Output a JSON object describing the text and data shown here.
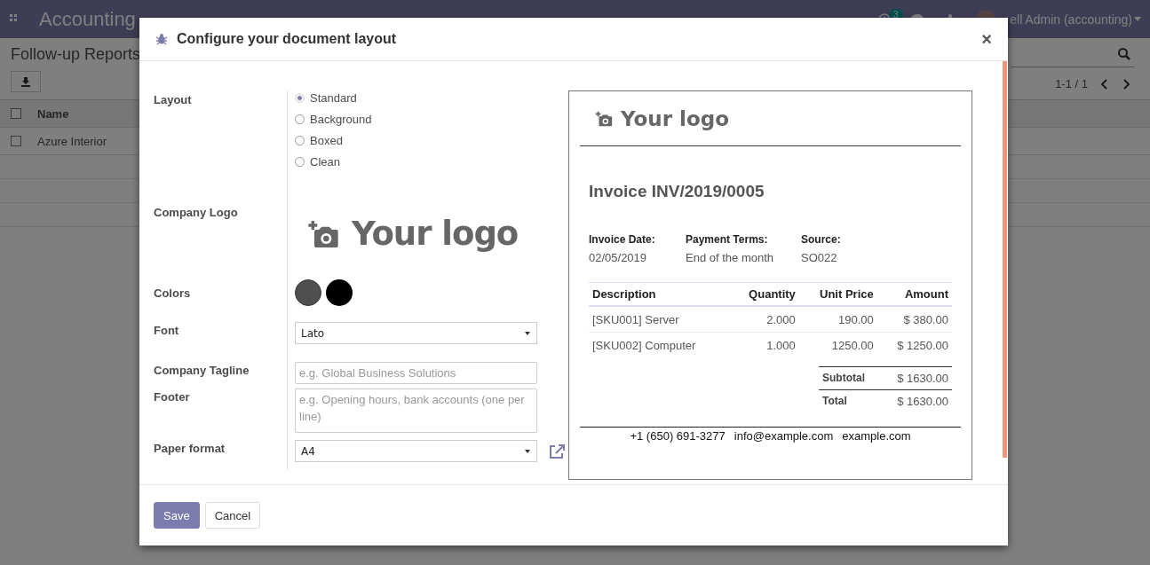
{
  "app": {
    "title": "Accounting",
    "messages_badge": "3",
    "user": "ell Admin (accounting)",
    "breadcrumb": "Follow-up Reports",
    "pager": "1-1 / 1",
    "list": {
      "column": "Name",
      "all_checked": false,
      "rows": [
        {
          "name": "Azure Interior",
          "checked": false
        }
      ]
    }
  },
  "dialog": {
    "title": "Configure your document layout",
    "close": "×",
    "fields": [
      {
        "kind": "radio",
        "label": "Layout",
        "options": [
          {
            "label": "Standard",
            "selected": true
          },
          {
            "label": "Background",
            "selected": false
          },
          {
            "label": "Boxed",
            "selected": false
          },
          {
            "label": "Clean",
            "selected": false
          }
        ]
      },
      {
        "kind": "logo",
        "label": "Company Logo",
        "logo_text": "Your logo"
      },
      {
        "kind": "colors",
        "label": "Colors",
        "colors": [
          {
            "color": "#4f4f4f"
          },
          {
            "color": "#000000"
          }
        ]
      },
      {
        "kind": "select",
        "label": "Font",
        "value": "Lato"
      },
      {
        "kind": "input",
        "label": "Company Tagline",
        "placeholder": "e.g. Global Business Solutions"
      },
      {
        "kind": "textarea",
        "label": "Footer",
        "placeholder": "e.g. Opening hours, bank accounts (one per line)"
      },
      {
        "kind": "select",
        "label": "Paper format",
        "value": "A4",
        "external_link": true
      }
    ],
    "preview": {
      "logo_text": "Your logo",
      "title": "Invoice INV/2019/0005",
      "info": [
        {
          "label": "Invoice Date:",
          "value": "02/05/2019"
        },
        {
          "label": "Payment Terms:",
          "value": "End of the month"
        },
        {
          "label": "Source:",
          "value": "SO022"
        }
      ],
      "columns": [
        "Description",
        "Quantity",
        "Unit Price",
        "Amount"
      ],
      "rows": [
        [
          "[SKU001] Server",
          "2.000",
          "190.00",
          "$ 380.00"
        ],
        [
          "[SKU002] Computer",
          "1.000",
          "1250.00",
          "$ 1250.00"
        ]
      ],
      "totals": [
        {
          "label": "Subtotal",
          "value": "$ 1630.00"
        },
        {
          "label": "Total",
          "value": "$ 1630.00"
        }
      ],
      "footer": [
        "+1 (650) 691-3277",
        "info@example.com",
        "example.com"
      ]
    },
    "buttons": [
      {
        "label": "Save",
        "primary": true
      },
      {
        "label": "Cancel",
        "primary": false
      }
    ]
  }
}
